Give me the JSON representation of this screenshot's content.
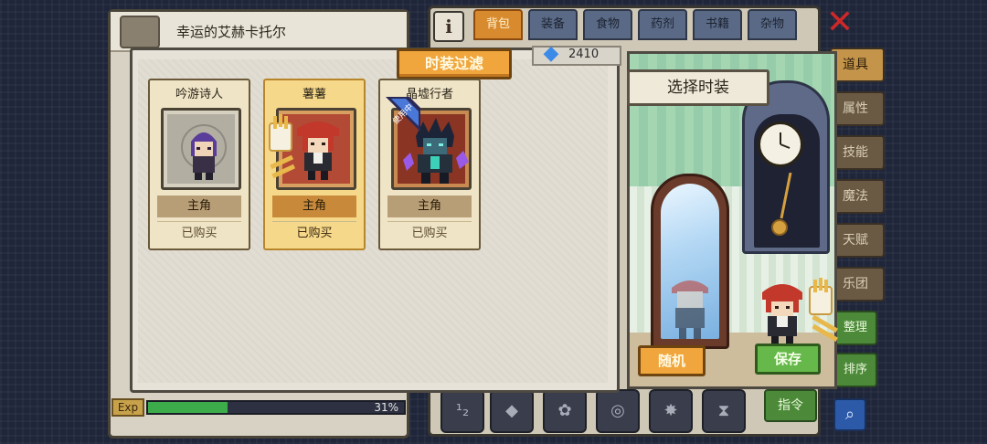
{
  "character_panel": {
    "name": "幸运的艾赫卡托尔",
    "exp_label": "Exp",
    "exp_percent": "31%",
    "exp_fraction": 0.31
  },
  "bag_panel": {
    "info_label": "i",
    "tabs": [
      {
        "label": "背包",
        "active": true
      },
      {
        "label": "装备",
        "active": false
      },
      {
        "label": "食物",
        "active": false
      },
      {
        "label": "药剂",
        "active": false
      },
      {
        "label": "书籍",
        "active": false
      },
      {
        "label": "杂物",
        "active": false
      }
    ],
    "side_tabs": [
      {
        "label": "道具",
        "active": true
      },
      {
        "label": "属性",
        "active": false
      },
      {
        "label": "技能",
        "active": false
      },
      {
        "label": "魔法",
        "active": false
      },
      {
        "label": "天赋",
        "active": false
      },
      {
        "label": "乐团",
        "active": false
      }
    ],
    "side_buttons": [
      "整理",
      "排序"
    ],
    "command_label": "指令",
    "close_icon": "close-icon",
    "search_icon": "search-icon"
  },
  "costume_filter": {
    "title": "时装过滤",
    "gems": "2410",
    "costumes": [
      {
        "name": "吟游诗人",
        "role": "主角",
        "status": "已购买",
        "selected": false
      },
      {
        "name": "薯薯",
        "role": "主角",
        "status": "已购买",
        "selected": true
      },
      {
        "name": "晶墟行者",
        "role": "主角",
        "status": "已购买",
        "selected": false,
        "badge": "使用中"
      }
    ]
  },
  "dressing_room": {
    "banner": "选择时装",
    "random_label": "随机",
    "save_label": "保存"
  },
  "colors": {
    "accent_orange": "#f0a63c",
    "save_green": "#66b84a",
    "exp_green": "#3cab4a",
    "close_red": "#d02828",
    "gem_blue": "#3c8ae8"
  }
}
